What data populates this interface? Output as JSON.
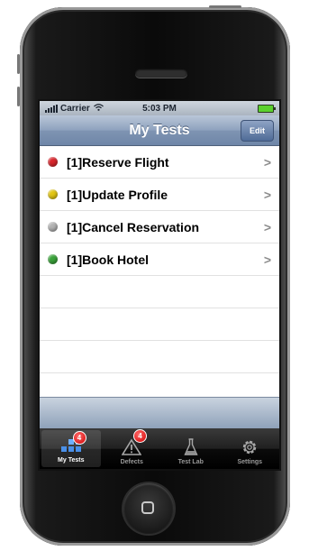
{
  "status_bar": {
    "carrier": "Carrier",
    "time": "5:03 PM"
  },
  "nav_bar": {
    "title": "My Tests",
    "edit_label": "Edit"
  },
  "tests": [
    {
      "label": "[1]Reserve Flight",
      "status_color": "#d9262c"
    },
    {
      "label": "[1]Update Profile",
      "status_color": "#e2c613"
    },
    {
      "label": "[1]Cancel Reservation",
      "status_color": "#b3b3b3"
    },
    {
      "label": "[1]Book Hotel",
      "status_color": "#3aa33a"
    }
  ],
  "tab_bar": {
    "tabs": [
      {
        "label": "My Tests",
        "icon": "tests-grid-icon",
        "badge": "4",
        "active": true
      },
      {
        "label": "Defects",
        "icon": "warning-triangle-icon",
        "badge": "4",
        "active": false
      },
      {
        "label": "Test Lab",
        "icon": "flask-icon",
        "active": false
      },
      {
        "label": "Settings",
        "icon": "gear-icon",
        "active": false
      }
    ]
  }
}
